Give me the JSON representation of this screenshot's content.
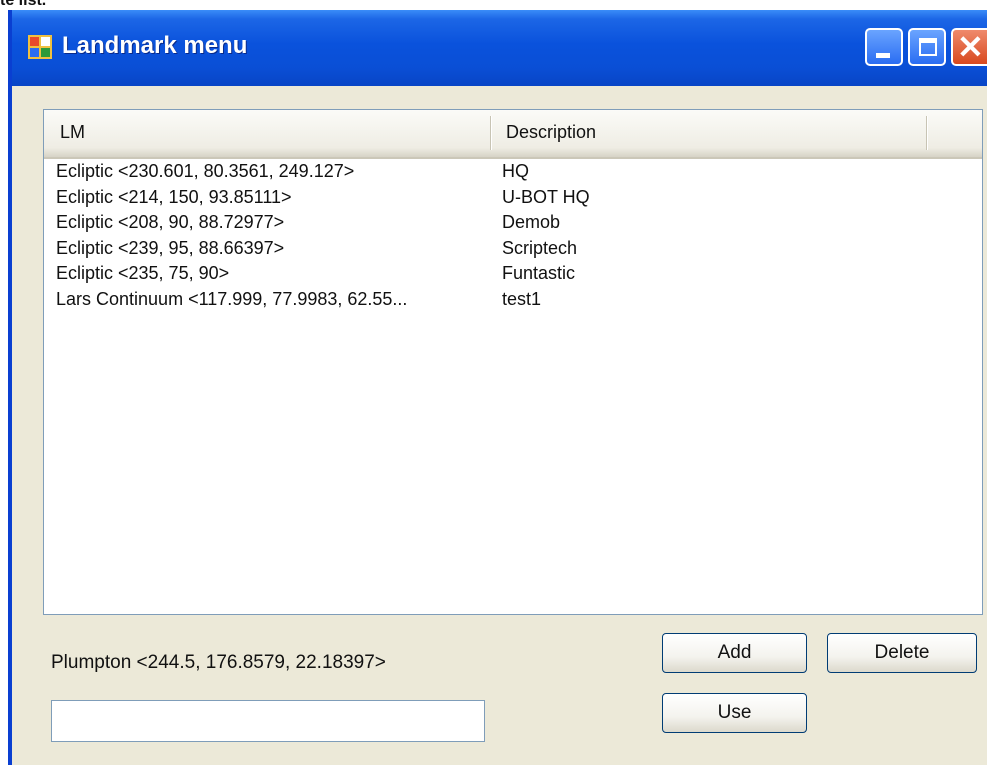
{
  "top_caption": "te list.",
  "window": {
    "title": "Landmark menu"
  },
  "list": {
    "columns": [
      "LM",
      "Description"
    ],
    "rows": [
      {
        "lm": "Ecliptic <230.601, 80.3561, 249.127>",
        "description": "HQ"
      },
      {
        "lm": "Ecliptic <214, 150, 93.85111>",
        "description": "U-BOT HQ"
      },
      {
        "lm": "Ecliptic <208, 90, 88.72977>",
        "description": "Demob"
      },
      {
        "lm": "Ecliptic <239, 95, 88.66397>",
        "description": "Scriptech"
      },
      {
        "lm": "Ecliptic <235, 75, 90>",
        "description": "Funtastic"
      },
      {
        "lm": "Lars Continuum  <117.999, 77.9983, 62.55...",
        "description": "test1"
      }
    ]
  },
  "current_location": "Plumpton <244.5, 176.8579, 22.18397>",
  "name_input": {
    "value": "",
    "placeholder": ""
  },
  "buttons": {
    "add": "Add",
    "delete": "Delete",
    "use": "Use"
  },
  "colors": {
    "titlebar": "#0a52dc",
    "window_bg": "#ece9d8",
    "close": "#d8491f"
  }
}
